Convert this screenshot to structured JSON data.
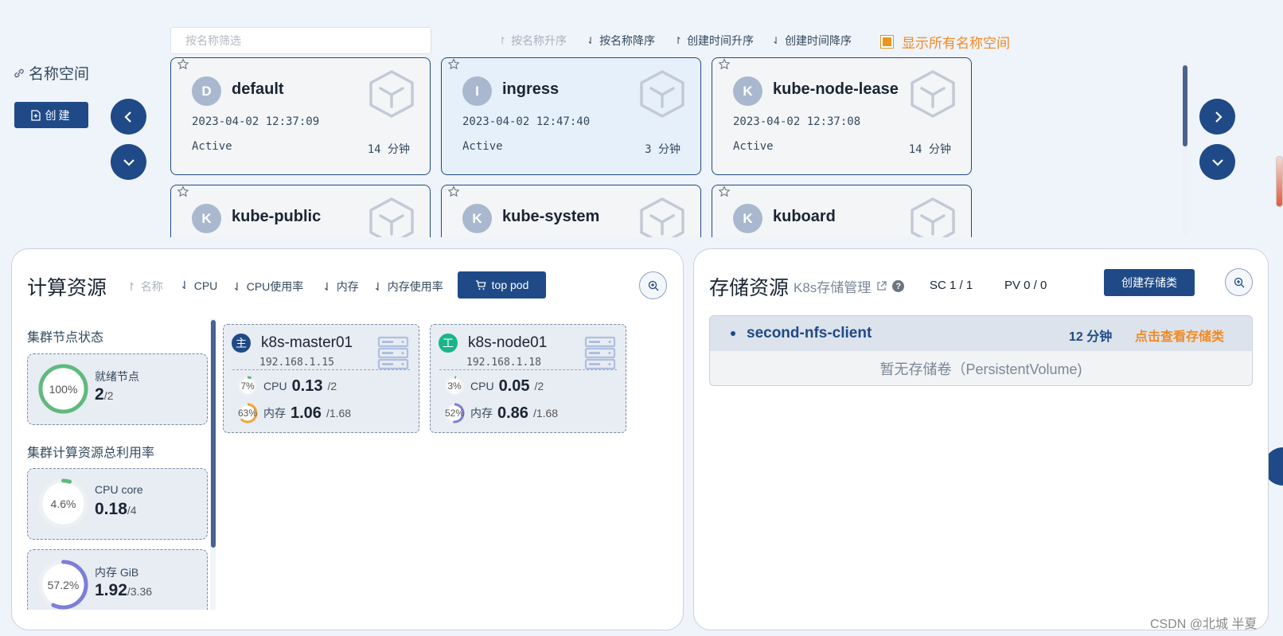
{
  "namespace": {
    "title": "名称空间",
    "create_label": "创建",
    "filter_placeholder": "按名称筛选",
    "sort_options": [
      "按名称升序",
      "按名称降序",
      "创建时间升序",
      "创建时间降序"
    ],
    "show_all_label": "显示所有名称空间",
    "show_all_checked": true,
    "cards": [
      {
        "initial": "D",
        "name": "default",
        "created": "2023-04-02 12:37:09",
        "status": "Active",
        "age": "14 分钟",
        "selected": false
      },
      {
        "initial": "I",
        "name": "ingress",
        "created": "2023-04-02 12:47:40",
        "status": "Active",
        "age": "3 分钟",
        "selected": true
      },
      {
        "initial": "K",
        "name": "kube-node-lease",
        "created": "2023-04-02 12:37:08",
        "status": "Active",
        "age": "14 分钟",
        "selected": false
      },
      {
        "initial": "K",
        "name": "kube-public",
        "selected": false
      },
      {
        "initial": "K",
        "name": "kube-system",
        "selected": false
      },
      {
        "initial": "K",
        "name": "kuboard",
        "selected": false
      }
    ]
  },
  "compute": {
    "title": "计算资源",
    "sort_options": [
      "名称",
      "CPU",
      "CPU使用率",
      "内存",
      "内存使用率"
    ],
    "top_pod_label": "top pod",
    "cluster_status_title": "集群节点状态",
    "ready_nodes": {
      "percent_label": "100%",
      "fraction": 1.0,
      "label": "就绪节点",
      "value": "2",
      "max": "/2"
    },
    "total_usage_title": "集群计算资源总利用率",
    "cpu": {
      "percent_label": "4.6%",
      "fraction": 0.046,
      "label": "CPU core",
      "value": "0.18",
      "max": "/4"
    },
    "memory": {
      "percent_label": "57.2%",
      "fraction": 0.572,
      "label": "内存 GiB",
      "value": "1.92",
      "max": "/3.36"
    },
    "nodes": [
      {
        "role": "主",
        "role_color": "#1f4a87",
        "name": "k8s-master01",
        "ip": "192.168.1.15",
        "cpu_pct": "7%",
        "cpu_fraction": 0.07,
        "cpu_label": "CPU",
        "cpu_val": "0.13",
        "cpu_max": "/2",
        "mem_pct": "63%",
        "mem_fraction": 0.63,
        "mem_label": "内存",
        "mem_val": "1.06",
        "mem_max": "/1.68"
      },
      {
        "role": "工",
        "role_color": "#19b58a",
        "name": "k8s-node01",
        "ip": "192.168.1.18",
        "cpu_pct": "3%",
        "cpu_fraction": 0.03,
        "cpu_label": "CPU",
        "cpu_val": "0.05",
        "cpu_max": "/2",
        "mem_pct": "52%",
        "mem_fraction": 0.52,
        "mem_label": "内存",
        "mem_val": "0.86",
        "mem_max": "/1.68"
      }
    ]
  },
  "storage": {
    "title": "存储资源",
    "link_label": "K8s存储管理",
    "sc_count": "SC 1 / 1",
    "pv_count": "PV 0 / 0",
    "create_label": "创建存储类",
    "storage_class": {
      "name": "second-nfs-client",
      "age": "12 分钟",
      "view_label": "点击查看存储类",
      "empty_text": "暂无存储卷（PersistentVolume)"
    }
  },
  "colors": {
    "primary": "#1f4a87",
    "accent": "#f08a24",
    "ring_green": "#5fba7d",
    "ring_orange": "#f0a43c",
    "ring_purple": "#7b7fd8"
  },
  "watermark": "CSDN @北城 半夏"
}
